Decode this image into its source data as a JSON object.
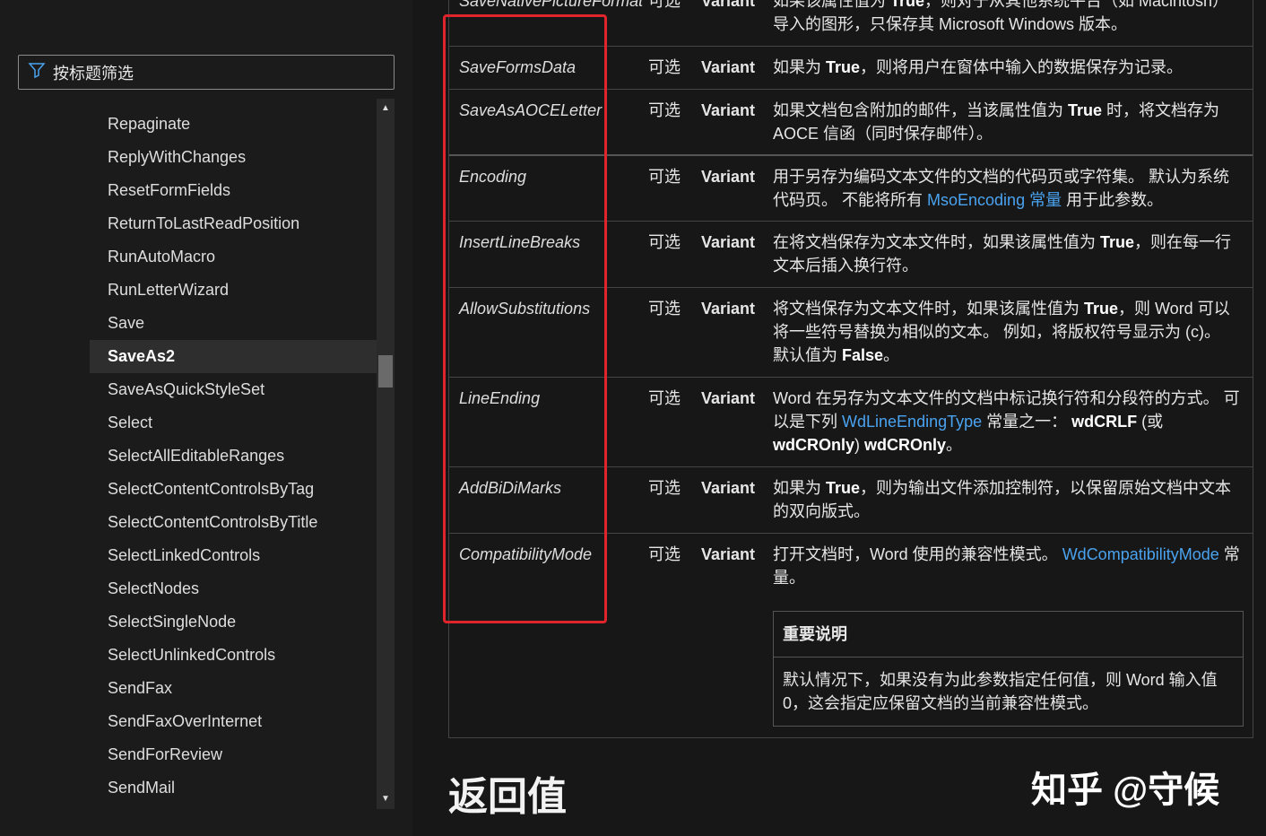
{
  "filter": {
    "placeholder": "按标题筛选"
  },
  "sidebar": {
    "items": [
      "Repaginate",
      "ReplyWithChanges",
      "ResetFormFields",
      "ReturnToLastReadPosition",
      "RunAutoMacro",
      "RunLetterWizard",
      "Save",
      "SaveAs2",
      "SaveAsQuickStyleSet",
      "Select",
      "SelectAllEditableRanges",
      "SelectContentControlsByTag",
      "SelectContentControlsByTitle",
      "SelectLinkedControls",
      "SelectNodes",
      "SelectSingleNode",
      "SelectUnlinkedControls",
      "SendFax",
      "SendFaxOverInternet",
      "SendForReview",
      "SendMail"
    ],
    "selected": "SaveAs2"
  },
  "table": {
    "rows": [
      {
        "name": "SaveNativePictureFormat",
        "opt": "可选",
        "type": "Variant",
        "desc": [
          [
            "t",
            "如果该属性值为 "
          ],
          [
            "b",
            "True"
          ],
          [
            "t",
            "，则对于从其他系统平台（如 Macintosh）导入的图形，只保存其 Microsoft Windows 版本。"
          ]
        ]
      },
      {
        "name": "SaveFormsData",
        "opt": "可选",
        "type": "Variant",
        "desc": [
          [
            "t",
            "如果为 "
          ],
          [
            "b",
            "True"
          ],
          [
            "t",
            "，则将用户在窗体中输入的数据保存为记录。"
          ]
        ]
      },
      {
        "name": "SaveAsAOCELetter",
        "opt": "可选",
        "type": "Variant",
        "desc": [
          [
            "t",
            "如果文档包含附加的邮件，当该属性值为 "
          ],
          [
            "b",
            "True"
          ],
          [
            "t",
            " 时，将文档存为 AOCE 信函（同时保存邮件）。"
          ]
        ]
      },
      {
        "name": "Encoding",
        "opt": "可选",
        "type": "Variant",
        "desc": [
          [
            "t",
            "用于另存为编码文本文件的文档的代码页或字符集。 默认为系统代码页。 不能将所有 "
          ],
          [
            "l",
            "MsoEncoding 常量"
          ],
          [
            "t",
            " 用于此参数。"
          ]
        ]
      },
      {
        "name": "InsertLineBreaks",
        "opt": "可选",
        "type": "Variant",
        "desc": [
          [
            "t",
            "在将文档保存为文本文件时，如果该属性值为 "
          ],
          [
            "b",
            "True"
          ],
          [
            "t",
            "，则在每一行文本后插入换行符。"
          ]
        ]
      },
      {
        "name": "AllowSubstitutions",
        "opt": "可选",
        "type": "Variant",
        "desc": [
          [
            "t",
            "将文档保存为文本文件时，如果该属性值为 "
          ],
          [
            "b",
            "True"
          ],
          [
            "t",
            "，则 Word 可以将一些符号替换为相似的文本。 例如，将版权符号显示为 (c)。 默认值为 "
          ],
          [
            "b",
            "False"
          ],
          [
            "t",
            "。"
          ]
        ]
      },
      {
        "name": "LineEnding",
        "opt": "可选",
        "type": "Variant",
        "desc": [
          [
            "t",
            "Word 在另存为文本文件的文档中标记换行符和分段符的方式。 可以是下列 "
          ],
          [
            "l",
            "WdLineEndingType"
          ],
          [
            "t",
            " 常量之一： "
          ],
          [
            "b",
            "wdCRLF"
          ],
          [
            "t",
            " (或 "
          ],
          [
            "b",
            "wdCROnly"
          ],
          [
            "t",
            ") "
          ],
          [
            "b",
            "wdCROnly"
          ],
          [
            "t",
            "。"
          ]
        ]
      },
      {
        "name": "AddBiDiMarks",
        "opt": "可选",
        "type": "Variant",
        "desc": [
          [
            "t",
            "如果为 "
          ],
          [
            "b",
            "True"
          ],
          [
            "t",
            "，则为输出文件添加控制符，以保留原始文档中文本的双向版式。"
          ]
        ]
      },
      {
        "name": "CompatibilityMode",
        "opt": "可选",
        "type": "Variant",
        "desc": [
          [
            "t",
            "打开文档时，Word 使用的兼容性模式。 "
          ],
          [
            "l",
            "WdCompatibilityMode"
          ],
          [
            "t",
            " 常量。"
          ]
        ]
      }
    ],
    "note": {
      "title": "重要说明",
      "text": "默认情况下，如果没有为此参数指定任何值，则 Word 输入值 0，这会指定应保留文档的当前兼容性模式。"
    }
  },
  "heading": "返回值",
  "watermark": "知乎 @守候",
  "colors": {
    "link": "#4aa3f0",
    "highlight": "#e0242b"
  }
}
